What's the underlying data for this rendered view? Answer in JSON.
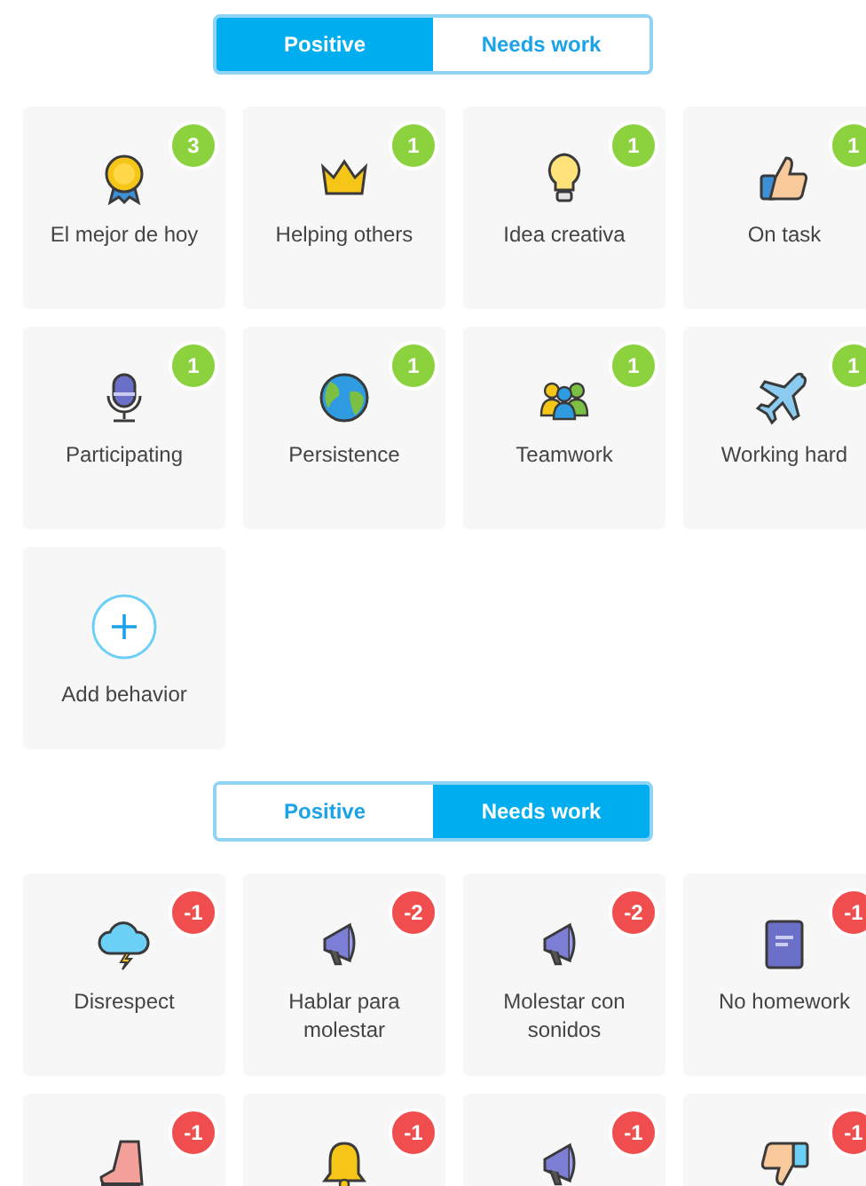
{
  "sections": [
    {
      "kind": "positive",
      "tabs": [
        {
          "label": "Positive",
          "selected": true
        },
        {
          "label": "Needs work",
          "selected": false
        }
      ],
      "behaviors": [
        {
          "name": "El mejor de hoy",
          "points": "3"
        },
        {
          "name": "Helping others",
          "points": "1"
        },
        {
          "name": "Idea creativa",
          "points": "1"
        },
        {
          "name": "On task",
          "points": "1"
        },
        {
          "name": "Participating",
          "points": "1"
        },
        {
          "name": "Persistence",
          "points": "1"
        },
        {
          "name": "Teamwork",
          "points": "1"
        },
        {
          "name": "Working hard",
          "points": "1"
        }
      ],
      "add_button": {
        "label": "Add behavior"
      }
    },
    {
      "kind": "negative",
      "tabs": [
        {
          "label": "Positive",
          "selected": false
        },
        {
          "label": "Needs work",
          "selected": true
        }
      ],
      "behaviors": [
        {
          "name": "Disrespect",
          "points": "-1"
        },
        {
          "name": "Hablar para molestar",
          "points": "-2"
        },
        {
          "name": "Molestar con sonidos",
          "points": "-2"
        },
        {
          "name": "No homework",
          "points": "-1"
        },
        {
          "points": "-1"
        },
        {
          "points": "-1"
        },
        {
          "points": "-1"
        },
        {
          "points": "-1"
        }
      ]
    }
  ]
}
